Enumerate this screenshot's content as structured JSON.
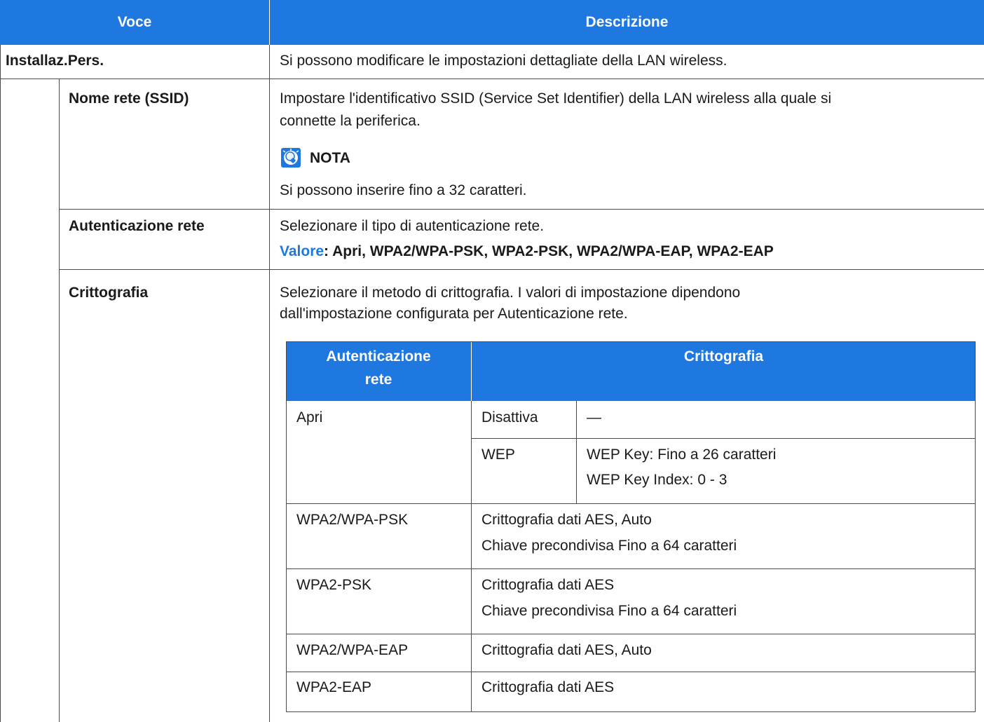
{
  "header": {
    "col1": "Voce",
    "col2": "Descrizione"
  },
  "rows": {
    "installaz": {
      "label": "Installaz.Pers.",
      "desc": "Si possono modificare le impostazioni dettagliate della LAN wireless."
    },
    "ssid": {
      "label": "Nome rete (SSID)",
      "desc_line1": "Impostare l'identificativo SSID (Service Set Identifier) della LAN wireless alla quale si",
      "desc_line2": "connette la periferica.",
      "note_title": "NOTA",
      "note_text": "Si possono inserire fino a 32 caratteri.",
      "note_icon": "note-bulb-icon"
    },
    "auth": {
      "label": "Autenticazione rete",
      "desc": "Selezionare il tipo di autenticazione rete.",
      "value_label": "Valore",
      "value_text": ": Apri, WPA2/WPA-PSK, WPA2-PSK, WPA2/WPA-EAP, WPA2-EAP"
    },
    "crypto": {
      "label": "Crittografia",
      "desc_line1": "Selezionare il metodo di crittografia. I valori di impostazione dipendono",
      "desc_line2": "dall'impostazione configurata per Autenticazione rete."
    }
  },
  "inner_table": {
    "header_col1_line1": "Autenticazione",
    "header_col1_line2": "rete",
    "header_col2": "Crittografia",
    "apri": {
      "auth": "Apri",
      "disattiva": "Disattiva",
      "disattiva_value": "—",
      "wep": "WEP",
      "wep_key": "WEP Key: Fino a 26 caratteri",
      "wep_index": "WEP Key Index: 0 - 3"
    },
    "wpa2_wpa_psk": {
      "auth": "WPA2/WPA-PSK",
      "line1": "Crittografia dati AES, Auto",
      "line2": "Chiave precondivisa Fino a 64 caratteri"
    },
    "wpa2_psk": {
      "auth": "WPA2-PSK",
      "line1": "Crittografia dati AES",
      "line2": "Chiave precondivisa Fino a 64 caratteri"
    },
    "wpa2_wpa_eap": {
      "auth": "WPA2/WPA-EAP",
      "line1": "Crittografia dati AES, Auto"
    },
    "wpa2_eap": {
      "auth": "WPA2-EAP",
      "line1": "Crittografia dati AES"
    }
  },
  "colors": {
    "accent": "#1f78e0",
    "border": "#4a4a4a"
  }
}
